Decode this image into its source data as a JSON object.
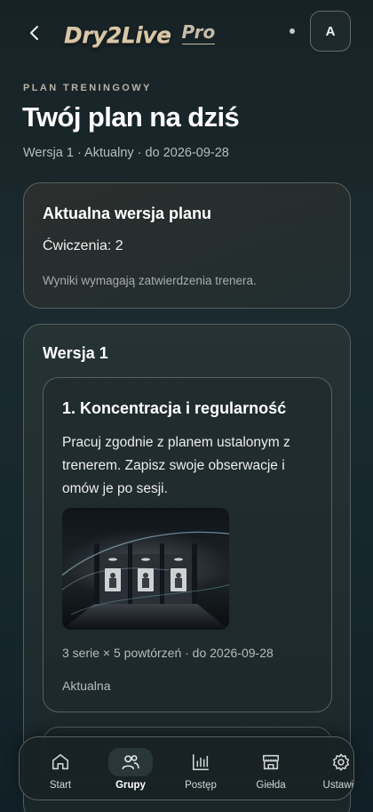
{
  "header": {
    "logo_main": "Dry2Live",
    "logo_pro": "Pro",
    "avatar_initial": "A",
    "back_icon": "chevron-left-icon"
  },
  "plan": {
    "eyebrow": "PLAN TRENINGOWY",
    "title": "Twój plan na dziś",
    "meta": "Wersja 1 · Aktualny · do 2026-09-28"
  },
  "current_version": {
    "title": "Aktualna wersja planu",
    "exercises": "Ćwiczenia: 2",
    "note": "Wyniki wymagają zatwierdzenia trenera."
  },
  "version": {
    "title": "Wersja 1",
    "exercises": [
      {
        "title": "1. Koncentracja i regularność",
        "description": "Pracuj zgodnie z planem ustalonym z trenerem. Zapisz swoje obserwacje i omów je po sesji.",
        "meta": "3 serie × 5 powtórzeń · do 2026-09-28",
        "status": "Aktualna"
      }
    ]
  },
  "nav": {
    "items": [
      {
        "label": "Start",
        "icon": "home-icon"
      },
      {
        "label": "Grupy",
        "icon": "users-icon",
        "active": true
      },
      {
        "label": "Postęp",
        "icon": "bar-chart-icon"
      },
      {
        "label": "Giełda",
        "icon": "store-icon"
      },
      {
        "label": "Ustawie",
        "icon": "gear-icon"
      }
    ]
  },
  "colors": {
    "background": "#172226",
    "card_border": "#55615f",
    "accent_gold": "#d8c7a8"
  }
}
